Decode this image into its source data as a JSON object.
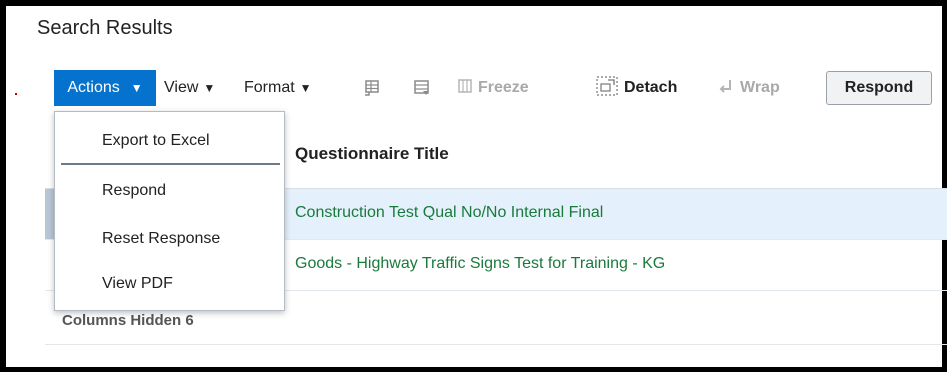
{
  "page": {
    "title": "Search Results"
  },
  "toolbar": {
    "actions_label": "Actions",
    "view_label": "View",
    "format_label": "Format",
    "freeze_label": "Freeze",
    "detach_label": "Detach",
    "wrap_label": "Wrap",
    "respond_label": "Respond",
    "caret": "▼"
  },
  "actions_menu": {
    "items": [
      {
        "label": "Export to Excel"
      },
      {
        "label": "Respond"
      },
      {
        "label": "Reset Response"
      },
      {
        "label": "View PDF"
      }
    ]
  },
  "table": {
    "column_header": "Questionnaire Title",
    "rows": [
      {
        "title": "Construction Test Qual No/No Internal Final",
        "selected": true
      },
      {
        "title": "Goods - Highway Traffic Signs Test for Training - KG",
        "selected": false
      }
    ],
    "columns_hidden_label": "Columns Hidden",
    "columns_hidden_count": "6"
  },
  "colors": {
    "accent": "#0572ce",
    "link_green": "#1a7a3c",
    "selected_row": "#e4f0fb"
  }
}
